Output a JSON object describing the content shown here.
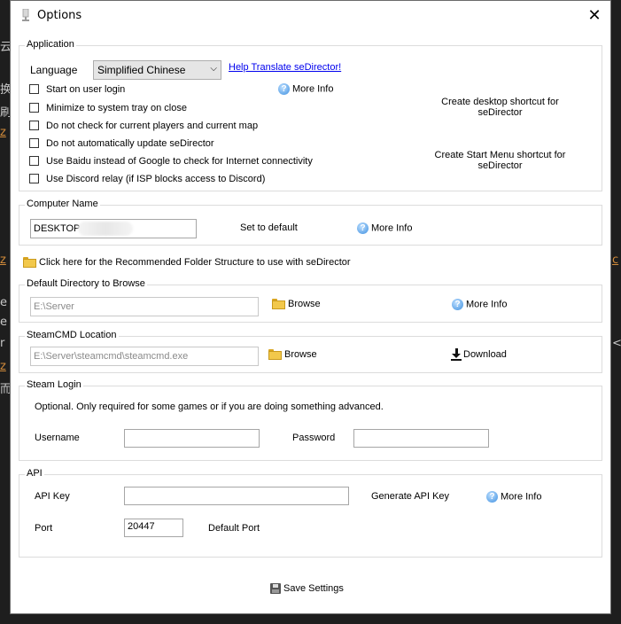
{
  "window": {
    "title": "Options",
    "close_glyph": "✕"
  },
  "application": {
    "legend": "Application",
    "language_label": "Language",
    "language_value": "Simplified Chinese",
    "help_translate_link": "Help Translate seDirector!",
    "options": [
      "Start on user login",
      "Minimize to system tray on close",
      "Do not check for current players and current map",
      "Do not automatically update seDirector",
      "Use Baidu instead of Google to check for Internet connectivity",
      "Use Discord relay (if ISP blocks access to Discord)"
    ],
    "more_info": "More Info",
    "desktop_shortcut": "Create desktop shortcut for seDirector",
    "start_menu_shortcut": "Create Start Menu shortcut for seDirector"
  },
  "computer_name": {
    "legend": "Computer Name",
    "value": "DESKTOP",
    "set_default": "Set to default",
    "more_info": "More Info"
  },
  "folder_structure_link": "Click here for the Recommended Folder Structure to use with seDirector",
  "default_directory": {
    "legend": "Default Directory to Browse",
    "value": "E:\\Server",
    "browse": "Browse",
    "more_info": "More Info"
  },
  "steamcmd": {
    "legend": "SteamCMD Location",
    "value": "E:\\Server\\steamcmd\\steamcmd.exe",
    "browse": "Browse",
    "download": "Download"
  },
  "steam_login": {
    "legend": "Steam Login",
    "note": "Optional. Only required for some games or if you are doing something advanced.",
    "username_label": "Username",
    "username_value": "",
    "password_label": "Password",
    "password_value": ""
  },
  "api": {
    "legend": "API",
    "key_label": "API Key",
    "key_value": "",
    "generate": "Generate API Key",
    "more_info": "More Info",
    "port_label": "Port",
    "port_value": "20447",
    "default_port": "Default Port"
  },
  "save_settings": "Save Settings",
  "icons": {
    "info": "info-icon",
    "folder": "folder-icon",
    "download": "download-icon",
    "save": "save-icon",
    "close": "close-icon"
  }
}
